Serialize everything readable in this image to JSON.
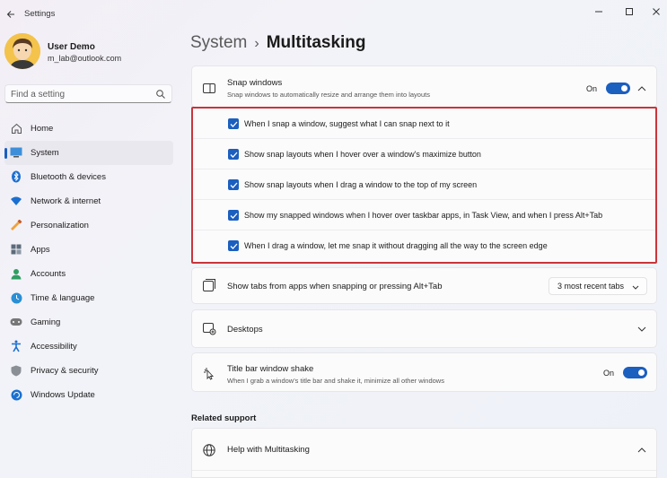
{
  "window": {
    "title": "Settings"
  },
  "profile": {
    "name": "User Demo",
    "email": "m_lab@outlook.com"
  },
  "search": {
    "placeholder": "Find a setting"
  },
  "sidebar": {
    "items": [
      {
        "label": "Home",
        "icon": "home-icon"
      },
      {
        "label": "System",
        "icon": "system-icon",
        "active": true
      },
      {
        "label": "Bluetooth & devices",
        "icon": "bluetooth-icon"
      },
      {
        "label": "Network & internet",
        "icon": "wifi-icon"
      },
      {
        "label": "Personalization",
        "icon": "brush-icon"
      },
      {
        "label": "Apps",
        "icon": "apps-icon"
      },
      {
        "label": "Accounts",
        "icon": "accounts-icon"
      },
      {
        "label": "Time & language",
        "icon": "globe-clock-icon"
      },
      {
        "label": "Gaming",
        "icon": "gamepad-icon"
      },
      {
        "label": "Accessibility",
        "icon": "accessibility-icon"
      },
      {
        "label": "Privacy & security",
        "icon": "shield-icon"
      },
      {
        "label": "Windows Update",
        "icon": "update-icon"
      }
    ]
  },
  "header": {
    "parent": "System",
    "separator": "›",
    "current": "Multitasking"
  },
  "snap": {
    "title": "Snap windows",
    "description": "Snap windows to automatically resize and arrange them into layouts",
    "toggle_label": "On",
    "options": [
      {
        "label": "When I snap a window, suggest what I can snap next to it",
        "checked": true
      },
      {
        "label": "Show snap layouts when I hover over a window's maximize button",
        "checked": true
      },
      {
        "label": "Show snap layouts when I drag a window to the top of my screen",
        "checked": true
      },
      {
        "label": "Show my snapped windows when I hover over taskbar apps, in Task View, and when I press Alt+Tab",
        "checked": true
      },
      {
        "label": "When I drag a window, let me snap it without dragging all the way to the screen edge",
        "checked": true
      }
    ]
  },
  "tabs_setting": {
    "title": "Show tabs from apps when snapping or pressing Alt+Tab",
    "value": "3 most recent tabs"
  },
  "desktops": {
    "title": "Desktops"
  },
  "shake": {
    "title": "Title bar window shake",
    "description": "When I grab a window's title bar and shake it, minimize all other windows",
    "toggle_label": "On"
  },
  "related": {
    "heading": "Related support",
    "help_title": "Help with Multitasking"
  },
  "colors": {
    "accent": "#1b5fbf",
    "highlight_border": "#c9353b"
  }
}
